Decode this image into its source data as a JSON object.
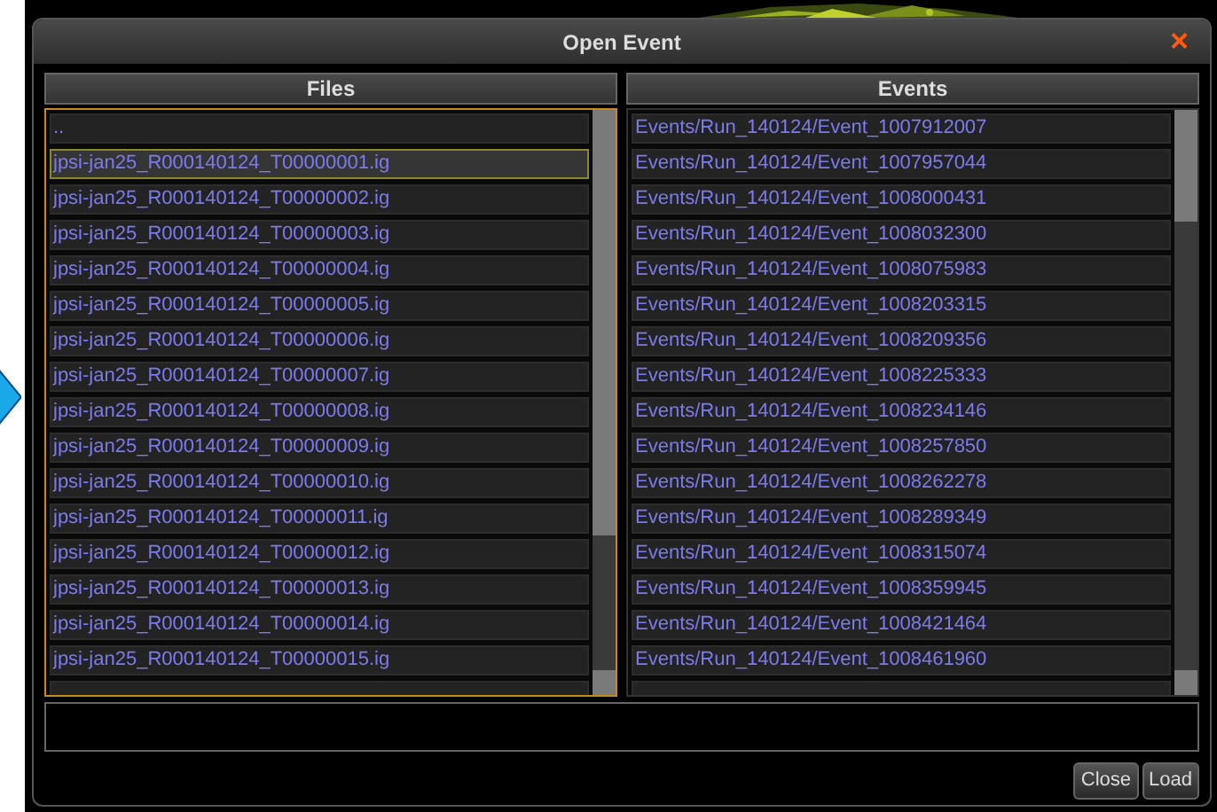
{
  "dialog": {
    "title": "Open Event",
    "close_glyph": "×"
  },
  "files": {
    "header": "Files",
    "focused": true,
    "items": [
      {
        "label": "..",
        "selected": false
      },
      {
        "label": "jpsi-jan25_R000140124_T00000001.ig",
        "selected": true
      },
      {
        "label": "jpsi-jan25_R000140124_T00000002.ig",
        "selected": false
      },
      {
        "label": "jpsi-jan25_R000140124_T00000003.ig",
        "selected": false
      },
      {
        "label": "jpsi-jan25_R000140124_T00000004.ig",
        "selected": false
      },
      {
        "label": "jpsi-jan25_R000140124_T00000005.ig",
        "selected": false
      },
      {
        "label": "jpsi-jan25_R000140124_T00000006.ig",
        "selected": false
      },
      {
        "label": "jpsi-jan25_R000140124_T00000007.ig",
        "selected": false
      },
      {
        "label": "jpsi-jan25_R000140124_T00000008.ig",
        "selected": false
      },
      {
        "label": "jpsi-jan25_R000140124_T00000009.ig",
        "selected": false
      },
      {
        "label": "jpsi-jan25_R000140124_T00000010.ig",
        "selected": false
      },
      {
        "label": "jpsi-jan25_R000140124_T00000011.ig",
        "selected": false
      },
      {
        "label": "jpsi-jan25_R000140124_T00000012.ig",
        "selected": false
      },
      {
        "label": "jpsi-jan25_R000140124_T00000013.ig",
        "selected": false
      },
      {
        "label": "jpsi-jan25_R000140124_T00000014.ig",
        "selected": false
      },
      {
        "label": "jpsi-jan25_R000140124_T00000015.ig",
        "selected": false
      }
    ]
  },
  "events": {
    "header": "Events",
    "focused": false,
    "items": [
      {
        "label": "Events/Run_140124/Event_1007912007",
        "selected": false
      },
      {
        "label": "Events/Run_140124/Event_1007957044",
        "selected": false
      },
      {
        "label": "Events/Run_140124/Event_1008000431",
        "selected": false
      },
      {
        "label": "Events/Run_140124/Event_1008032300",
        "selected": false
      },
      {
        "label": "Events/Run_140124/Event_1008075983",
        "selected": false
      },
      {
        "label": "Events/Run_140124/Event_1008203315",
        "selected": false
      },
      {
        "label": "Events/Run_140124/Event_1008209356",
        "selected": false
      },
      {
        "label": "Events/Run_140124/Event_1008225333",
        "selected": false
      },
      {
        "label": "Events/Run_140124/Event_1008234146",
        "selected": false
      },
      {
        "label": "Events/Run_140124/Event_1008257850",
        "selected": false
      },
      {
        "label": "Events/Run_140124/Event_1008262278",
        "selected": false
      },
      {
        "label": "Events/Run_140124/Event_1008289349",
        "selected": false
      },
      {
        "label": "Events/Run_140124/Event_1008315074",
        "selected": false
      },
      {
        "label": "Events/Run_140124/Event_1008359945",
        "selected": false
      },
      {
        "label": "Events/Run_140124/Event_1008421464",
        "selected": false
      },
      {
        "label": "Events/Run_140124/Event_1008461960",
        "selected": false
      }
    ]
  },
  "buttons": [
    "Close",
    "Load"
  ]
}
